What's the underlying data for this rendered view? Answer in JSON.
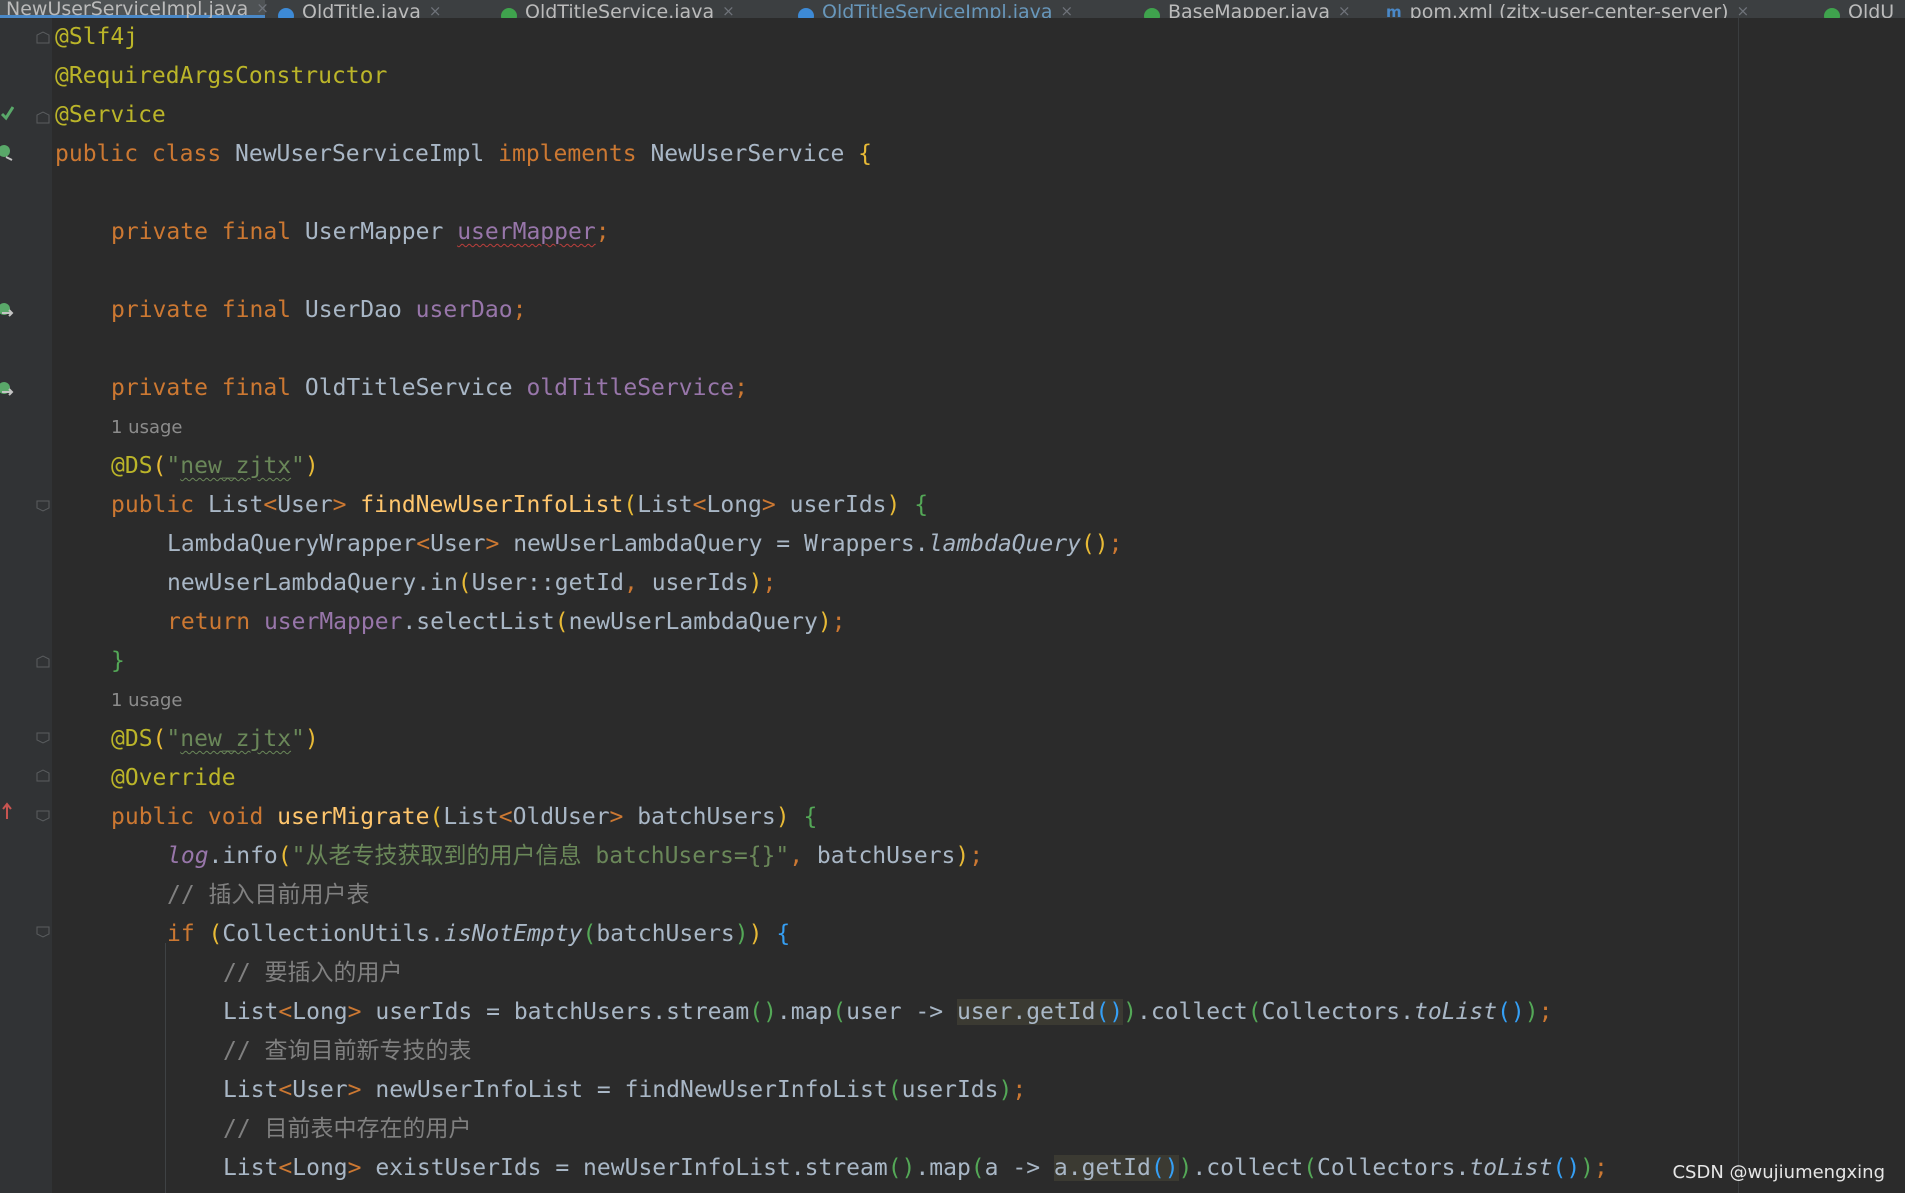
{
  "tabs": [
    {
      "label": "NewUserServiceImpl.java",
      "close": "×"
    },
    {
      "label": "OldTitle.java",
      "close": "×"
    },
    {
      "label": "OldTitleService.java",
      "close": "×"
    },
    {
      "label": "OldTitleServiceImpl.java",
      "close": "×"
    },
    {
      "label": "BaseMapper.java",
      "close": "×"
    },
    {
      "label": "pom.xml (zjtx-user-center-server)",
      "close": "×"
    },
    {
      "label": "OldU",
      "close": ""
    }
  ],
  "tab_icons": {
    "maven": "m"
  },
  "hints": {
    "usage1": "1 usage",
    "usage2": "1 usage"
  },
  "code": {
    "l01": "@Slf4j",
    "l02": "@RequiredArgsConstructor",
    "l03": "@Service",
    "l04": {
      "a": "public class ",
      "b": "NewUserServiceImpl ",
      "c": "implements ",
      "d": "NewUserService ",
      "e": "{"
    },
    "l06": {
      "a": "private final ",
      "b": "UserMapper ",
      "c": "userMapper",
      "d": ";"
    },
    "l08": {
      "a": "private final ",
      "b": "UserDao ",
      "c": "userDao",
      "d": ";"
    },
    "l10": {
      "a": "private final ",
      "b": "OldTitleService ",
      "c": "oldTitleService",
      "d": ";"
    },
    "l12": {
      "a": "@DS",
      "b": "(",
      "c": "\"",
      "d": "new_zjtx",
      "e": "\"",
      "f": ")"
    },
    "l13": {
      "a": "public ",
      "b": "List",
      "c": "<",
      "d": "User",
      "e": "> ",
      "f": "findNewUserInfoList",
      "g": "(",
      "h": "List",
      "i": "<",
      "j": "Long",
      "k": "> ",
      "l": "userIds",
      "m": ") ",
      "n": "{"
    },
    "l14": {
      "a": "LambdaQueryWrapper",
      "b": "<",
      "c": "User",
      "d": "> ",
      "e": "newUserLambdaQuery = Wrappers.",
      "f": "lambdaQuery",
      "g": "()",
      "h": ";"
    },
    "l15": {
      "a": "newUserLambdaQuery.in",
      "b": "(",
      "c": "User::getId",
      "d": ", ",
      "e": "userIds",
      "f": ")",
      "g": ";"
    },
    "l16": {
      "a": "return ",
      "b": "userMapper",
      "c": ".selectList",
      "d": "(",
      "e": "newUserLambdaQuery",
      "f": ")",
      "g": ";"
    },
    "l17": "}",
    "l19": {
      "a": "@DS",
      "b": "(",
      "c": "\"",
      "d": "new_zjtx",
      "e": "\"",
      "f": ")"
    },
    "l20": "@Override",
    "l21": {
      "a": "public void ",
      "b": "userMigrate",
      "c": "(",
      "d": "List",
      "e": "<",
      "f": "OldUser",
      "g": "> ",
      "h": "batchUsers",
      "i": ") ",
      "j": "{"
    },
    "l22": {
      "a": "log",
      "b": ".info",
      "c": "(",
      "d": "\"从老专技获取到的用户信息 batchUsers={}\"",
      "e": ", ",
      "f": "batchUsers",
      "g": ")",
      "h": ";"
    },
    "l23": "// 插入目前用户表",
    "l24": {
      "a": "if ",
      "b": "(",
      "c": "CollectionUtils.",
      "d": "isNotEmpty",
      "e": "(",
      "f": "batchUsers",
      "g": ")",
      "h": ")",
      "i": " {"
    },
    "l25": "// 要插入的用户",
    "l26": {
      "a": "List",
      "b": "<",
      "c": "Long",
      "d": "> ",
      "e": "userIds = batchUsers.stream",
      "f": "()",
      "g": ".map",
      "h": "(",
      "i": "user -> ",
      "j": "user.getId",
      "k": "()",
      "l": ")",
      "m": ".collect",
      "n": "(",
      "o": "Collectors.",
      "p": "toList",
      "q": "()",
      "r": ")",
      "s": ";"
    },
    "l27": "// 查询目前新专技的表",
    "l28": {
      "a": "List",
      "b": "<",
      "c": "User",
      "d": "> ",
      "e": "newUserInfoList = findNewUserInfoList",
      "f": "(",
      "g": "userIds",
      "h": ")",
      "i": ";"
    },
    "l29": "// 目前表中存在的用户",
    "l30": {
      "a": "List",
      "b": "<",
      "c": "Long",
      "d": "> ",
      "e": "existUserIds = newUserInfoList.stream",
      "f": "()",
      "g": ".map",
      "h": "(",
      "i": "a -> ",
      "j": "a.getId",
      "k": "()",
      "l": ")",
      "m": ".collect",
      "n": "(",
      "o": "Collectors.",
      "p": "toList",
      "q": "()",
      "r": ")",
      "s": ";"
    }
  },
  "watermark": "CSDN @wujiumengxing",
  "colors": {
    "background": "#2b2b2b",
    "keyword": "#cc7832",
    "annotation": "#bbb529",
    "string": "#6a8759",
    "comment": "#808080",
    "field": "#9876aa",
    "method": "#ffc66d"
  }
}
